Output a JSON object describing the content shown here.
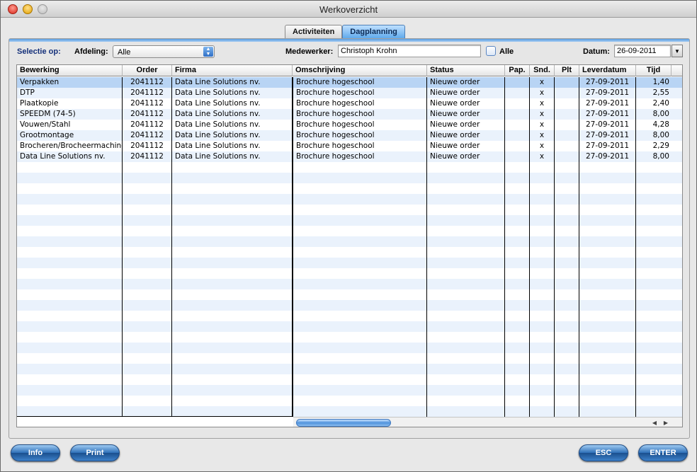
{
  "window": {
    "title": "Werkoverzicht"
  },
  "tabs": [
    {
      "label": "Activiteiten",
      "active": false
    },
    {
      "label": "Dagplanning",
      "active": true
    }
  ],
  "filters": {
    "selectie_label": "Selectie op:",
    "afdeling_label": "Afdeling:",
    "afdeling_value": "Alle",
    "medewerker_label": "Medewerker:",
    "medewerker_value": "Christoph Krohn",
    "alle_label": "Alle",
    "alle_checked": false,
    "datum_label": "Datum:",
    "datum_value": "26-09-2011"
  },
  "table": {
    "columns": [
      "Bewerking",
      "Order",
      "Firma",
      "Omschrijving",
      "Status",
      "Pap.",
      "Snd.",
      "Plt",
      "Leverdatum",
      "Tijd"
    ],
    "rows": [
      [
        "Verpakken",
        "2041112",
        "Data Line Solutions nv.",
        "Brochure hogeschool",
        "Nieuwe order",
        "",
        "x",
        "",
        "27-09-2011",
        "1,40"
      ],
      [
        "DTP",
        "2041112",
        "Data Line Solutions nv.",
        "Brochure hogeschool",
        "Nieuwe order",
        "",
        "x",
        "",
        "27-09-2011",
        "2,55"
      ],
      [
        "Plaatkopie",
        "2041112",
        "Data Line Solutions nv.",
        "Brochure hogeschool",
        "Nieuwe order",
        "",
        "x",
        "",
        "27-09-2011",
        "2,40"
      ],
      [
        "SPEEDM (74-5)",
        "2041112",
        "Data Line Solutions nv.",
        "Brochure hogeschool",
        "Nieuwe order",
        "",
        "x",
        "",
        "27-09-2011",
        "8,00"
      ],
      [
        "Vouwen/Stahl",
        "2041112",
        "Data Line Solutions nv.",
        "Brochure hogeschool",
        "Nieuwe order",
        "",
        "x",
        "",
        "27-09-2011",
        "4,28"
      ],
      [
        "Grootmontage",
        "2041112",
        "Data Line Solutions nv.",
        "Brochure hogeschool",
        "Nieuwe order",
        "",
        "x",
        "",
        "27-09-2011",
        "8,00"
      ],
      [
        "Brocheren/Brocheermachine",
        "2041112",
        "Data Line Solutions nv.",
        "Brochure hogeschool",
        "Nieuwe order",
        "",
        "x",
        "",
        "27-09-2011",
        "2,29"
      ],
      [
        "Data Line Solutions nv.",
        "2041112",
        "Data Line Solutions nv.",
        "Brochure hogeschool",
        "Nieuwe order",
        "",
        "x",
        "",
        "27-09-2011",
        "8,00"
      ]
    ],
    "selected_row": 0
  },
  "buttons": {
    "info": "Info",
    "print": "Print",
    "esc": "ESC",
    "enter": "ENTER"
  },
  "colors": {
    "selected_row": "#b8d4f4",
    "stripe": "#eaf2fc",
    "accent": "#2d6fb8"
  }
}
